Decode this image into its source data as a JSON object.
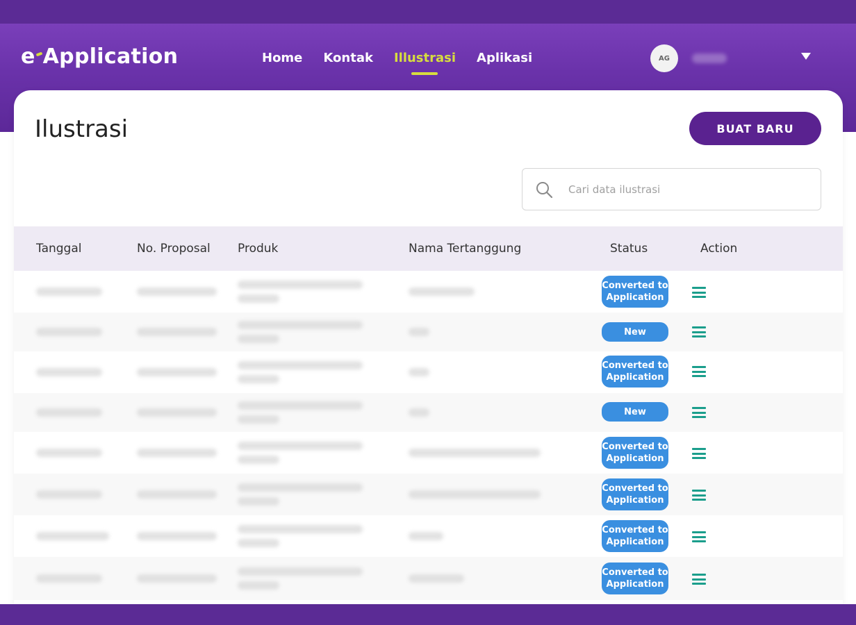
{
  "brand": {
    "logo_prefix": "e",
    "logo_suffix": "Application"
  },
  "nav": {
    "items": [
      {
        "label": "Home",
        "active": false
      },
      {
        "label": "Kontak",
        "active": false
      },
      {
        "label": "Illustrasi",
        "active": true
      },
      {
        "label": "Aplikasi",
        "active": false
      }
    ]
  },
  "user": {
    "initials": "AG"
  },
  "page": {
    "title": "Ilustrasi",
    "new_button_label": "BUAT BARU",
    "search_placeholder": "Cari data ilustrasi"
  },
  "table": {
    "columns": [
      "Tanggal",
      "No. Proposal",
      "Produk",
      "Nama Tertanggung",
      "Status",
      "Action"
    ],
    "rows": [
      {
        "status": "Converted to Application"
      },
      {
        "status": "New"
      },
      {
        "status": "Converted to Application"
      },
      {
        "status": "New"
      },
      {
        "status": "Converted to Application"
      },
      {
        "status": "Converted to Application"
      },
      {
        "status": "Converted to Application"
      },
      {
        "status": "Converted to Application"
      }
    ]
  },
  "colors": {
    "header_purple": "#6a32aa",
    "accent_yellow": "#d7dd3f",
    "button_purple": "#5a2290",
    "badge_blue": "#3a8fe0",
    "action_teal": "#1b9e8c",
    "table_head_bg": "#eeeaf4"
  },
  "icons": {
    "search": "search-icon",
    "user_menu": "chevron-down-icon",
    "row_action": "hamburger-menu-icon"
  }
}
